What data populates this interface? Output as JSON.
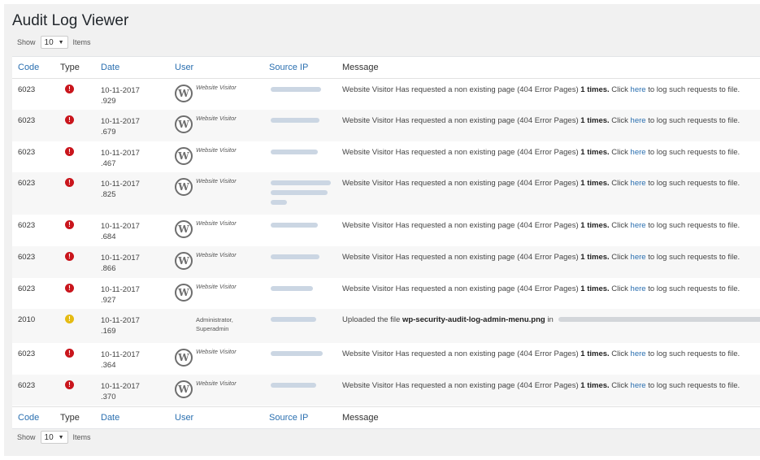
{
  "page": {
    "title": "Audit Log Viewer"
  },
  "pagination": {
    "show_label": "Show",
    "per_page": "10",
    "items_label": "Items"
  },
  "columns": [
    "Code",
    "Type",
    "Date",
    "User",
    "Source IP",
    "Message"
  ],
  "colors": {
    "error": "#c9151c",
    "warning": "#e5bb12",
    "link": "#2a6fb0"
  },
  "icons": {
    "error": "exclamation-circle-icon",
    "warning": "exclamation-circle-icon",
    "avatar": "wordpress-logo-icon"
  },
  "rows": [
    {
      "code": "6023",
      "type": "error",
      "date": "10-11-2017",
      "ms": ".929",
      "user": "Website Visitor",
      "msg_pre": "Website Visitor Has requested a non existing page (404 Error Pages)",
      "msg_bold": "1 times.",
      "msg_mid": "Click",
      "msg_link": "here",
      "msg_post": "to log such requests to file."
    },
    {
      "code": "6023",
      "type": "error",
      "date": "10-11-2017",
      "ms": ".679",
      "user": "Website Visitor",
      "msg_pre": "Website Visitor Has requested a non existing page (404 Error Pages)",
      "msg_bold": "1 times.",
      "msg_mid": "Click",
      "msg_link": "here",
      "msg_post": "to log such requests to file."
    },
    {
      "code": "6023",
      "type": "error",
      "date": "10-11-2017",
      "ms": ".467",
      "user": "Website Visitor",
      "msg_pre": "Website Visitor Has requested a non existing page (404 Error Pages)",
      "msg_bold": "1 times.",
      "msg_mid": "Click",
      "msg_link": "here",
      "msg_post": "to log such requests to file."
    },
    {
      "code": "6023",
      "type": "error",
      "date": "10-11-2017",
      "ms": ".825",
      "user": "Website Visitor",
      "msg_pre": "Website Visitor Has requested a non existing page (404 Error Pages)",
      "msg_bold": "1 times.",
      "msg_mid": "Click",
      "msg_link": "here",
      "msg_post": "to log such requests to file."
    },
    {
      "code": "6023",
      "type": "error",
      "date": "10-11-2017",
      "ms": ".684",
      "user": "Website Visitor",
      "msg_pre": "Website Visitor Has requested a non existing page (404 Error Pages)",
      "msg_bold": "1 times.",
      "msg_mid": "Click",
      "msg_link": "here",
      "msg_post": "to log such requests to file."
    },
    {
      "code": "6023",
      "type": "error",
      "date": "10-11-2017",
      "ms": ".866",
      "user": "Website Visitor",
      "msg_pre": "Website Visitor Has requested a non existing page (404 Error Pages)",
      "msg_bold": "1 times.",
      "msg_mid": "Click",
      "msg_link": "here",
      "msg_post": "to log such requests to file."
    },
    {
      "code": "6023",
      "type": "error",
      "date": "10-11-2017",
      "ms": ".927",
      "user": "Website Visitor",
      "msg_pre": "Website Visitor Has requested a non existing page (404 Error Pages)",
      "msg_bold": "1 times.",
      "msg_mid": "Click",
      "msg_link": "here",
      "msg_post": "to log such requests to file."
    },
    {
      "code": "2010",
      "type": "warning",
      "date": "10-11-2017",
      "ms": ".169",
      "user_line1": "Administrator,",
      "user_line2": "Superadmin",
      "msg_upload": "Uploaded the file",
      "msg_file": "wp-security-audit-log-admin-menu.png",
      "msg_in": "in"
    },
    {
      "code": "6023",
      "type": "error",
      "date": "10-11-2017",
      "ms": ".364",
      "user": "Website Visitor",
      "msg_pre": "Website Visitor Has requested a non existing page (404 Error Pages)",
      "msg_bold": "1 times.",
      "msg_mid": "Click",
      "msg_link": "here",
      "msg_post": "to log such requests to file."
    },
    {
      "code": "6023",
      "type": "error",
      "date": "10-11-2017",
      "ms": ".370",
      "user": "Website Visitor",
      "msg_pre": "Website Visitor Has requested a non existing page (404 Error Pages)",
      "msg_bold": "1 times.",
      "msg_mid": "Click",
      "msg_link": "here",
      "msg_post": "to log such requests to file."
    }
  ]
}
